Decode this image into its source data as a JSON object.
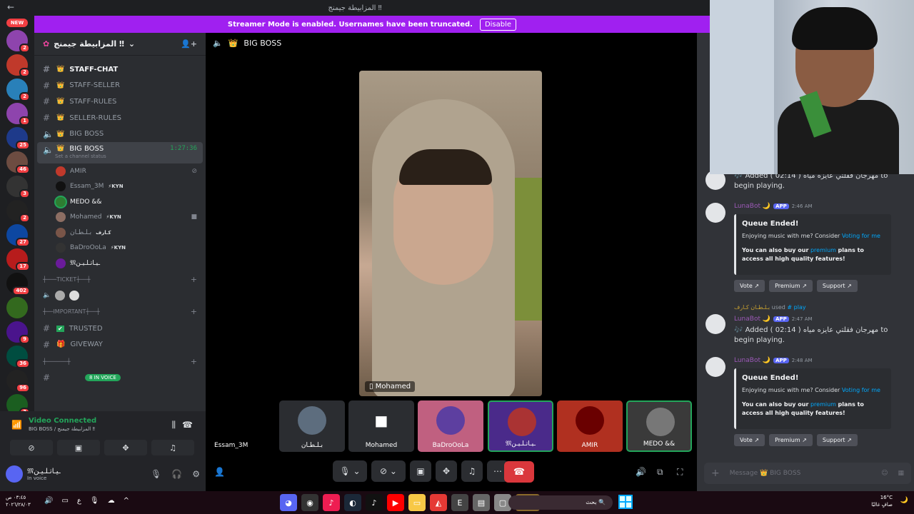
{
  "titlebar": {
    "title": "المزابيطة جيمنج ‼"
  },
  "streamer": {
    "text": "Streamer Mode is enabled. Usernames have been truncated.",
    "button": "Disable"
  },
  "servers": {
    "badges": [
      "2",
      "2",
      "2",
      "1",
      "25",
      "46",
      "3",
      "2",
      "27",
      "17",
      "402",
      "9",
      "36",
      "96",
      "3"
    ],
    "new_label": "NEW"
  },
  "guild": {
    "name": "المزابيطة جيمنج ‼"
  },
  "channels": [
    {
      "name": "STAFF-CHAT",
      "type": "text"
    },
    {
      "name": "STAFF-SELLER",
      "type": "text"
    },
    {
      "name": "STAFF-RULES",
      "type": "text"
    },
    {
      "name": "SELLER-RULES",
      "type": "text"
    },
    {
      "name": "BIG BOSS",
      "type": "voice"
    }
  ],
  "active_channel": {
    "name": "BIG BOSS",
    "timer": "1:27:36",
    "status": "Set a channel status"
  },
  "voice_users": [
    {
      "name": "AMIR",
      "tag": "",
      "color": "#c0392b"
    },
    {
      "name": "Essam_3M",
      "tag": "⚡KYN",
      "color": "#111111"
    },
    {
      "name": "MEDO &&",
      "tag": "",
      "color": "#2e7d32"
    },
    {
      "name": "Mohamed",
      "tag": "⚡KYN",
      "color": "#8d6e63"
    },
    {
      "name": "بـلـطـان",
      "tag": "كـارف",
      "color": "#795548"
    },
    {
      "name": "BaDroOoLa",
      "tag": "⚡KYN",
      "color": "#333333"
    },
    {
      "name": "𝔐ـيـاتـلـيـن",
      "tag": "",
      "color": "#6a1b9a"
    }
  ],
  "categories": {
    "ticket": "┼───TICKET┼──┼",
    "important": "┼──IMPORTANT┼──┼",
    "other": "┼──────┼"
  },
  "lower_channels": [
    {
      "name": "TRUSTED"
    },
    {
      "name": "GIVEWAY"
    }
  ],
  "in_voice_pill": "8 IN VOICE",
  "voice_connected": {
    "title": "Video Connected",
    "subtitle": "BIG BOSS / المزابيطة جيمنج ‼"
  },
  "user_panel": {
    "name": "𝔐ـيـاتـلـيـن",
    "status": "In voice"
  },
  "stage": {
    "channel": "BIG BOSS",
    "main_label": "Mohamed"
  },
  "tiles": [
    {
      "name": "Essam_3M",
      "color": "#000000"
    },
    {
      "name": "بـلـطـان",
      "color": "#5d6d7e"
    },
    {
      "name": "Mohamed",
      "color": "#2b2d31"
    },
    {
      "name": "BaDroOoLa",
      "color": "#c06080"
    },
    {
      "name": "𝔐ـيـاتـلـيـن",
      "color": "#4a2a8a"
    },
    {
      "name": "AMIR",
      "color": "#b03020"
    },
    {
      "name": "MEDO &&",
      "color": "#3a3a3a"
    }
  ],
  "chat": {
    "messages": [
      {
        "kind": "text",
        "text": "🎶 Added ( 02:14 ) مهرجان فقلتي عايزه مياه to begin playing."
      },
      {
        "kind": "bot",
        "bot": "LunaBot 🌙",
        "time": "2:46 AM",
        "embed_title": "Queue Ended!",
        "embed_line1": "Enjoying music with me? Consider",
        "embed_link1": "Voting for me",
        "embed_line2a": "You can also buy our",
        "embed_link2": "premium",
        "embed_line2b": "plans to access all high quality features!",
        "buttons": [
          "Vote ↗",
          "Premium ↗",
          "Support ↗"
        ]
      },
      {
        "kind": "cmd",
        "user": "بـلـطـان كـارف",
        "used": "used",
        "command": "# play",
        "bot": "LunaBot 🌙",
        "time": "2:47 AM",
        "text": "🎶 Added ( 02:14 ) مهرجان فقلتي عايزه مياه to begin playing."
      },
      {
        "kind": "bot",
        "bot": "LunaBot 🌙",
        "time": "2:48 AM",
        "embed_title": "Queue Ended!",
        "embed_line1": "Enjoying music with me? Consider",
        "embed_link1": "Voting for me",
        "embed_line2a": "You can also buy our",
        "embed_link2": "premium",
        "embed_line2b": "plans to access all high quality features!",
        "buttons": [
          "Vote ↗",
          "Premium ↗",
          "Support ↗"
        ]
      }
    ],
    "app_badge": "APP",
    "placeholder": "Message 👑 BIG BOSS"
  },
  "taskbar": {
    "time": "٠٣:٤٥ ص",
    "date": "٢٠٢٦/٢٨/٠٣",
    "search": "بحث",
    "temp": "16°C",
    "weather": "صافٍ غالبًا"
  },
  "colors": {
    "accent": "#5865f2",
    "streamer": "#a020f0",
    "green": "#23a55a",
    "hangup": "#da373c"
  }
}
